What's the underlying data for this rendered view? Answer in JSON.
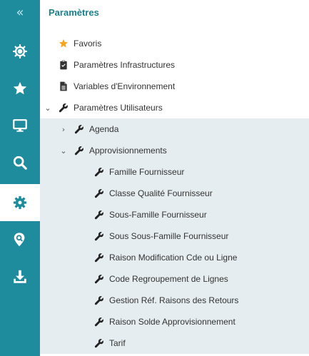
{
  "rail": {
    "collapse_glyph": "«",
    "items": [
      {
        "icon": "helm-wheel-icon"
      },
      {
        "icon": "star-icon"
      },
      {
        "icon": "monitor-icon"
      },
      {
        "icon": "search-icon"
      },
      {
        "icon": "gear-icon",
        "active": true
      },
      {
        "icon": "location-search-icon"
      },
      {
        "icon": "download-icon"
      }
    ]
  },
  "panel": {
    "title": "Paramètres",
    "tree": {
      "favoris": "Favoris",
      "infra": "Paramètres Infrastructures",
      "env": "Variables d'Environnement",
      "users": "Paramètres Utilisateurs",
      "agenda": "Agenda",
      "appro": "Approvisionnements",
      "appro_children": [
        "Famille Fournisseur",
        "Classe Qualité Fournisseur",
        "Sous-Famille Fournisseur",
        "Sous Sous-Famille Fournisseur",
        "Raison Modification Cde ou Ligne",
        "Code Regroupement de Lignes",
        "Gestion Réf. Raisons des Retours",
        "Raison Solde Approvisionnement",
        "Tarif"
      ]
    }
  },
  "colors": {
    "rail": "#1e8c9c",
    "title": "#1a7f8e",
    "star": "#f5a623",
    "selected_bg": "#e6edf1"
  }
}
